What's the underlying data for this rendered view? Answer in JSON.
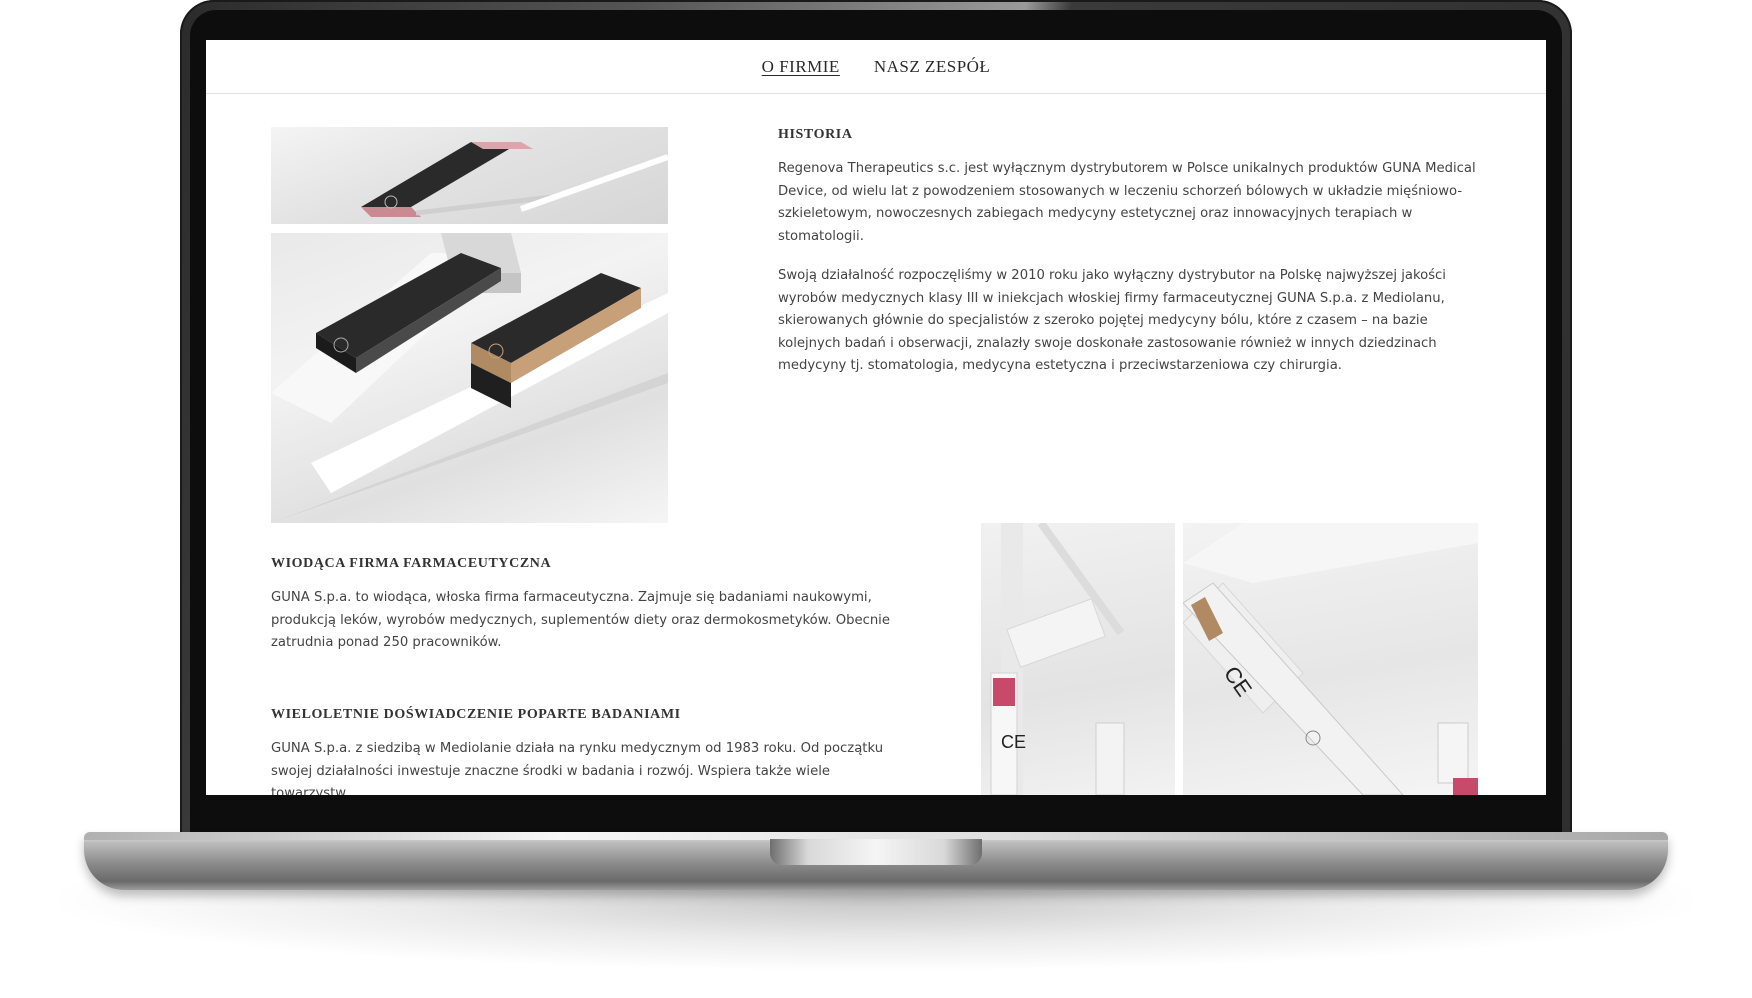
{
  "nav": {
    "items": [
      {
        "label": "O FIRMIE",
        "active": true
      },
      {
        "label": "NASZ ZESPÓŁ",
        "active": false
      }
    ]
  },
  "historia": {
    "title": "HISTORIA",
    "p1": "Regenova Therapeutics s.c. jest wyłącznym dystrybutorem w Polsce unikalnych produktów GUNA  Medical Device, od wielu lat z powodzeniem stosowanych w leczeniu schorzeń bólowych w układzie mięśniowo-szkieletowym, nowoczesnych zabiegach medycyny estetycznej oraz innowacyjnych terapiach w stomatologii.",
    "p2": "Swoją działalność rozpoczęliśmy w 2010 roku jako wyłączny dystrybutor na Polskę najwyższej jakości wyrobów medycznych klasy III w iniekcjach włoskiej firmy farmaceutycznej GUNA S.p.a. z Mediolanu, skierowanych głównie do specjalistów z szeroko pojętej medycyny bólu, które z czasem – na bazie kolejnych badań i obserwacji, znalazły swoje doskonałe zastosowanie również w innych dziedzinach medycyny tj. stomatologia, medycyna estetyczna i przeciwstarzeniowa czy chirurgia."
  },
  "wiodaca": {
    "title": "WIODĄCA FIRMA FARMACEUTYCZNA",
    "p1": "GUNA S.p.a. to wiodąca, włoska firma farmaceutyczna. Zajmuje się badaniami naukowymi, produkcją leków, wyrobów medycznych, suplementów diety oraz dermokosmetyków. Obecnie zatrudnia ponad 250 pracowników."
  },
  "wieloletnie": {
    "title": "WIELOLETNIE DOŚWIADCZENIE POPARTE BADANIAMI",
    "p1": "GUNA S.p.a. z siedzibą w Mediolanie działa na rynku medycznym od 1983 roku. Od początku swojej działalności inwestuje znaczne środki w badania i rozwój. Wspiera także wiele towarzystw"
  },
  "colors": {
    "bezel": "#2f2f2f",
    "screen_bg": "#ffffff",
    "text": "#444444",
    "heading": "#333333",
    "rose_accent": "#c98a92",
    "gold_accent": "#b08a63",
    "product_dark": "#2a2a2a"
  }
}
